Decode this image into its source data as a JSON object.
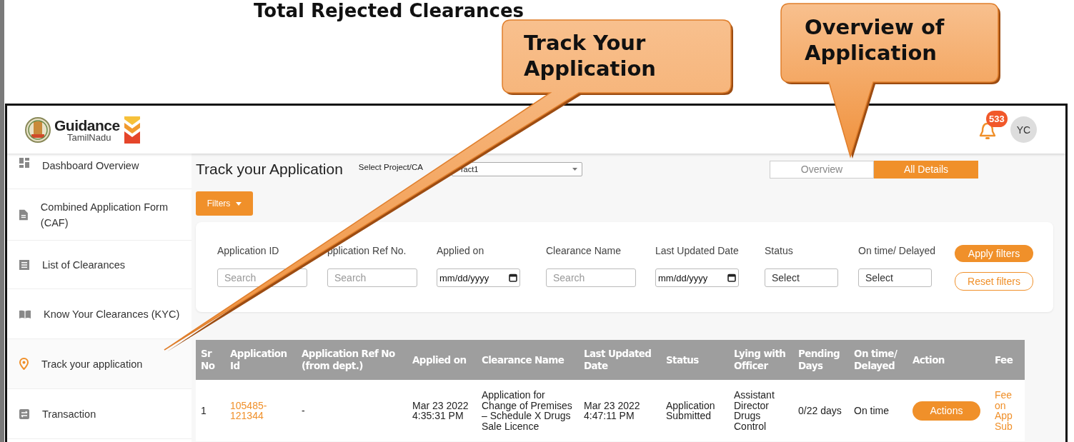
{
  "page_heading": "Total Rejected Clearances",
  "callouts": [
    {
      "text": "Track Your Application"
    },
    {
      "text": "Overview of Application"
    }
  ],
  "header": {
    "logo_title": "Guidance",
    "logo_subtitle": "TamilNadu",
    "notification_count": "533",
    "avatar": "YC"
  },
  "sidebar": {
    "items": [
      {
        "label": "Dashboard Overview",
        "selected": false
      },
      {
        "label": "Combined Application Form (CAF)",
        "selected": false
      },
      {
        "label": "List of Clearances",
        "selected": false
      },
      {
        "label": "Know Your Clearances (KYC)",
        "selected": false
      },
      {
        "label": "Track your application",
        "selected": true
      },
      {
        "label": "Transaction",
        "selected": false
      }
    ]
  },
  "page": {
    "title": "Track your Application",
    "project_select": {
      "label": "Select Project/CA",
      "value": "ract1"
    },
    "view_tabs": [
      {
        "label": "Overview",
        "selected": false
      },
      {
        "label": "All Details",
        "selected": true
      }
    ],
    "filters_button": "Filters"
  },
  "filters": {
    "fields": [
      {
        "label": "Application ID",
        "kind": "text",
        "placeholder": "Search"
      },
      {
        "label": "pplication Ref No.",
        "kind": "text",
        "placeholder": "Search"
      },
      {
        "label": "Applied on",
        "kind": "date",
        "value": "mm/dd/yyyy"
      },
      {
        "label": "Clearance Name",
        "kind": "text",
        "placeholder": "Search"
      },
      {
        "label": "Last Updated Date",
        "kind": "date",
        "value": "mm/dd/yyyy"
      },
      {
        "label": "Status",
        "kind": "select",
        "value": "Select"
      },
      {
        "label": "On time/ Delayed",
        "kind": "select",
        "value": "Select"
      }
    ],
    "apply": "Apply filters",
    "reset": "Reset filters"
  },
  "table": {
    "columns": [
      {
        "label": "Sr No",
        "kind": "text"
      },
      {
        "label": "Application Id",
        "kind": "link"
      },
      {
        "label": "Application Ref No (from dept.)",
        "kind": "text"
      },
      {
        "label": "Applied on",
        "kind": "text"
      },
      {
        "label": "Clearance Name",
        "kind": "text"
      },
      {
        "label": "Last Updated Date",
        "kind": "text"
      },
      {
        "label": "Status",
        "kind": "text"
      },
      {
        "label": "Lying with Officer",
        "kind": "text"
      },
      {
        "label": "Pending Days",
        "kind": "text"
      },
      {
        "label": "On time/ Delayed",
        "kind": "text"
      },
      {
        "label": "Action",
        "kind": "button"
      },
      {
        "label": "Fee",
        "kind": "link"
      }
    ],
    "rows": [
      {
        "cells": [
          "1",
          "105485-121344",
          "-",
          "Mar 23 2022 4:35:31 PM",
          "Application for Change of Premises – Schedule X Drugs Sale Licence",
          "Mar 23 2022 4:47:11 PM",
          "Application Submitted",
          "Assistant Director Drugs Control",
          "0/22 days",
          "On time",
          "Actions",
          "Fee on App Sub"
        ]
      }
    ]
  }
}
